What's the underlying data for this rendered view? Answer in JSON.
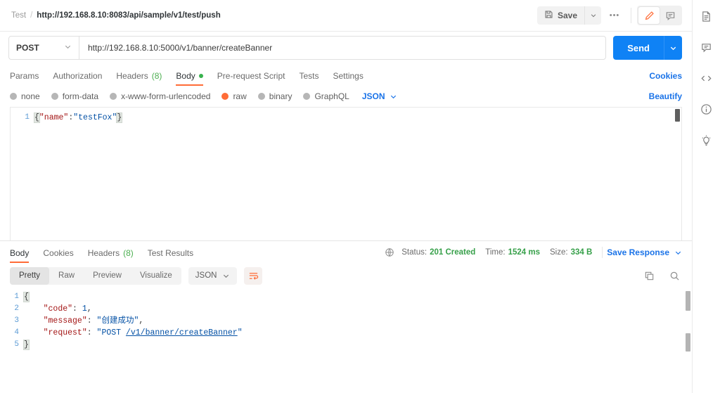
{
  "breadcrumb": {
    "root": "Test",
    "separator": "/",
    "leaf": "http://192.168.8.10:8083/api/sample/v1/test/push"
  },
  "topbar": {
    "save_label": "Save",
    "more_label": "•••"
  },
  "request": {
    "method": "POST",
    "url": "http://192.168.8.10:5000/v1/banner/createBanner",
    "send_label": "Send",
    "tabs": [
      {
        "label": "Params",
        "active": false
      },
      {
        "label": "Authorization",
        "active": false
      },
      {
        "label": "Headers",
        "count": "(8)",
        "active": false
      },
      {
        "label": "Body",
        "active": true,
        "dot": true
      },
      {
        "label": "Pre-request Script",
        "active": false
      },
      {
        "label": "Tests",
        "active": false
      },
      {
        "label": "Settings",
        "active": false
      }
    ],
    "cookies_link": "Cookies",
    "beautify_link": "Beautify",
    "body_types": [
      {
        "label": "none",
        "selected": false
      },
      {
        "label": "form-data",
        "selected": false
      },
      {
        "label": "x-www-form-urlencoded",
        "selected": false
      },
      {
        "label": "raw",
        "selected": true
      },
      {
        "label": "binary",
        "selected": false
      },
      {
        "label": "GraphQL",
        "selected": false
      }
    ],
    "format_selected": "JSON",
    "body_line_numbers": [
      "1"
    ],
    "body_tokens": {
      "open_brace": "{",
      "key_name": "\"name\"",
      "colon": ":",
      "value_name": "\"testFox\"",
      "close_brace": "}"
    }
  },
  "response": {
    "tabs": [
      {
        "label": "Body",
        "active": true
      },
      {
        "label": "Cookies",
        "active": false
      },
      {
        "label": "Headers",
        "count": "(8)",
        "active": false
      },
      {
        "label": "Test Results",
        "active": false
      }
    ],
    "status_label": "Status:",
    "status_value": "201 Created",
    "time_label": "Time:",
    "time_value": "1524 ms",
    "size_label": "Size:",
    "size_value": "334 B",
    "save_response_label": "Save Response",
    "view_modes": [
      {
        "label": "Pretty",
        "active": true
      },
      {
        "label": "Raw",
        "active": false
      },
      {
        "label": "Preview",
        "active": false
      },
      {
        "label": "Visualize",
        "active": false
      }
    ],
    "format_selected": "JSON",
    "line_numbers": [
      "1",
      "2",
      "3",
      "4",
      "5"
    ],
    "body_tokens": {
      "l1_open": "{",
      "l2_key": "\"code\"",
      "l2_sep": ": ",
      "l2_val": "1",
      "l2_comma": ",",
      "l3_key": "\"message\"",
      "l3_sep": ": ",
      "l3_val": "\"创建成功\"",
      "l3_comma": ",",
      "l4_key": "\"request\"",
      "l4_sep": ": ",
      "l4_val_pre": "\"POST ",
      "l4_val_link": "/v1/banner/createBanner",
      "l4_val_post": "\"",
      "l5_close": "}"
    }
  },
  "colors": {
    "accent_orange": "#ff6c37",
    "link_blue": "#1a73e8",
    "send_blue": "#0f82f5",
    "status_green": "#37a04a"
  }
}
